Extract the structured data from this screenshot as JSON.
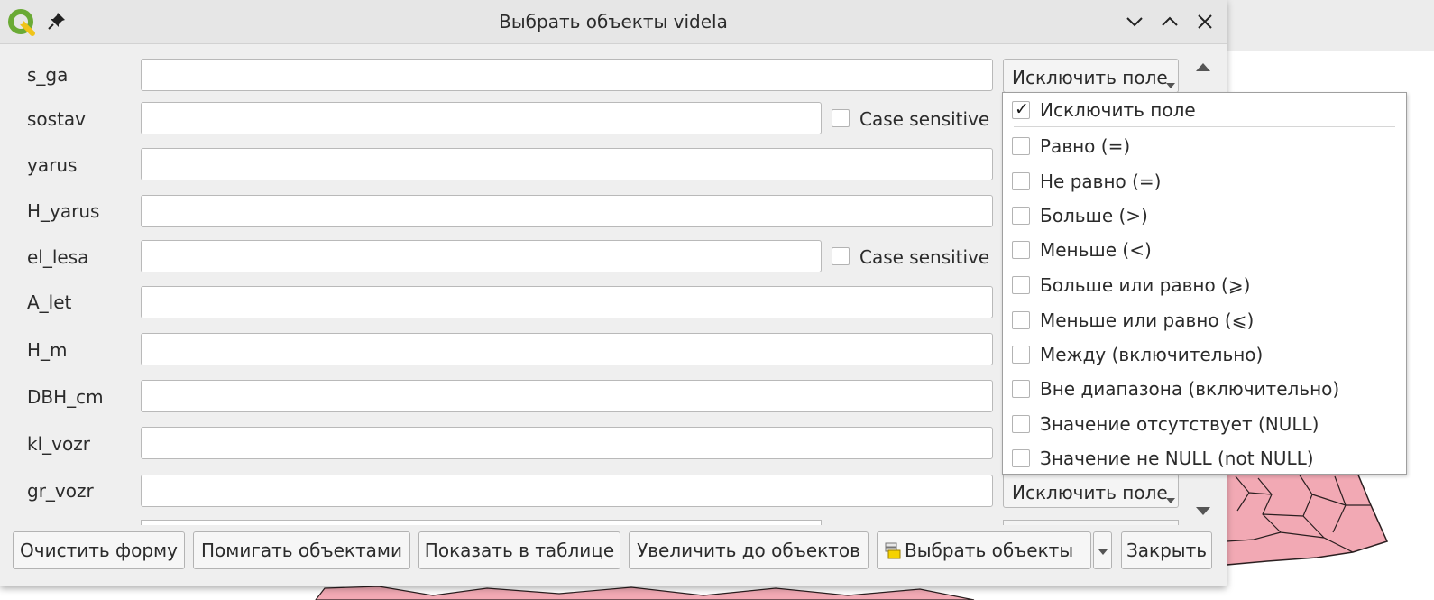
{
  "window": {
    "title": "Выбрать объекты videla",
    "icons": {
      "app": "qgis-logo",
      "pin": "pin-icon",
      "minimize": "chevron-down-icon",
      "maximize": "chevron-up-icon",
      "close": "close-icon"
    }
  },
  "fields": [
    {
      "name": "s_ga",
      "value": "",
      "case_sensitive": null,
      "combo": "Исключить поле"
    },
    {
      "name": "sostav",
      "value": "",
      "case_sensitive": "Case sensitive",
      "combo": null
    },
    {
      "name": "yarus",
      "value": "",
      "case_sensitive": null,
      "combo": null
    },
    {
      "name": "H_yarus",
      "value": "",
      "case_sensitive": null,
      "combo": null
    },
    {
      "name": "el_lesa",
      "value": "",
      "case_sensitive": "Case sensitive",
      "combo": null
    },
    {
      "name": "A_let",
      "value": "",
      "case_sensitive": null,
      "combo": null
    },
    {
      "name": "H_m",
      "value": "",
      "case_sensitive": null,
      "combo": null
    },
    {
      "name": "DBH_cm",
      "value": "",
      "case_sensitive": null,
      "combo": null
    },
    {
      "name": "kl_vozr",
      "value": "",
      "case_sensitive": null,
      "combo": null
    },
    {
      "name": "gr_vozr",
      "value": "",
      "case_sensitive": null,
      "combo": "Исключить поле"
    }
  ],
  "operator_menu": {
    "items": [
      {
        "label": "Исключить поле",
        "checked": true
      },
      {
        "label": "Равно (=)",
        "checked": false
      },
      {
        "label": "Не равно (=)",
        "checked": false
      },
      {
        "label": "Больше (>)",
        "checked": false
      },
      {
        "label": "Меньше (<)",
        "checked": false
      },
      {
        "label": "Больше или равно (⩾)",
        "checked": false
      },
      {
        "label": "Меньше или равно (⩽)",
        "checked": false
      },
      {
        "label": "Между (включительно)",
        "checked": false
      },
      {
        "label": "Вне диапазона (включительно)",
        "checked": false
      },
      {
        "label": "Значение отсутствует (NULL)",
        "checked": false
      },
      {
        "label": "Значение не NULL (not NULL)",
        "checked": false
      }
    ]
  },
  "buttons": {
    "clear_form": "Очистить форму",
    "flash": "Помигать объектами",
    "show_in_table": "Показать в таблице",
    "zoom": "Увеличить до объектов",
    "select": "Выбрать объекты",
    "close": "Закрыть"
  },
  "colors": {
    "dialog_bg": "#efefef",
    "titlebar_bg": "#e6e6e6",
    "map_fill": "#f2a9b4",
    "map_stroke": "#2b1f20",
    "qgis_green": "#6aaa35"
  }
}
